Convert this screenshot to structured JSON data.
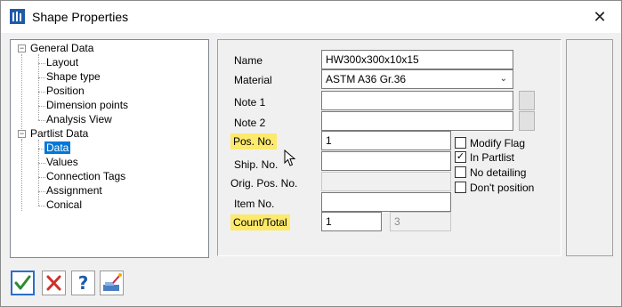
{
  "window": {
    "title": "Shape Properties",
    "close_glyph": "✕"
  },
  "tree": {
    "groups": [
      {
        "label": "General Data",
        "expander": "−",
        "items": [
          "Layout",
          "Shape type",
          "Position",
          "Dimension points",
          "Analysis View"
        ]
      },
      {
        "label": "Partlist Data",
        "expander": "−",
        "items": [
          "Data",
          "Values",
          "Connection Tags",
          "Assignment",
          "Conical"
        ]
      }
    ],
    "selected": "Data"
  },
  "form": {
    "name_label": "Name",
    "name_value": "HW300x300x10x15",
    "material_label": "Material",
    "material_value": "ASTM A36 Gr.36",
    "note1_label": "Note 1",
    "note1_value": "",
    "note2_label": "Note 2",
    "note2_value": "",
    "pos_no_label": "Pos. No.",
    "pos_no_value": "1",
    "ship_no_label": "Ship. No.",
    "ship_no_value": "",
    "orig_pos_no_label": "Orig. Pos. No.",
    "orig_pos_no_value": "",
    "item_no_label": "Item No.",
    "item_no_value": "",
    "count_total_label": "Count/Total",
    "count_value": "1",
    "total_value": "3",
    "highlight_color": "#fde96b"
  },
  "flags": {
    "modify_flag": {
      "label": "Modify Flag",
      "checked": false
    },
    "in_partlist": {
      "label": "In Partlist",
      "checked": true
    },
    "no_detailing": {
      "label": "No detailing",
      "checked": false
    },
    "dont_position": {
      "label": "Don't position",
      "checked": false
    }
  },
  "check_glyph": "✓",
  "buttons": {
    "ok_icon": "checkmark-icon",
    "cancel_icon": "cross-icon",
    "help_icon": "help-question-icon",
    "help_glyph": "?",
    "pick_icon": "pick-from-model-icon"
  }
}
